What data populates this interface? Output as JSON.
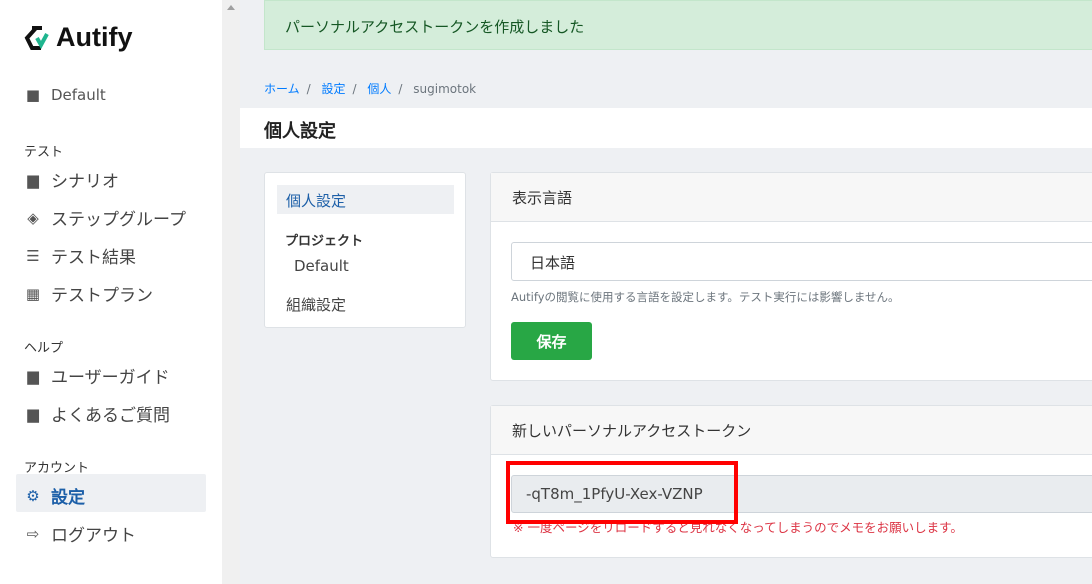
{
  "brand": "Autify",
  "sidebar": {
    "project": "Default",
    "sections": [
      {
        "title": "テスト",
        "items": [
          "シナリオ",
          "ステップグループ",
          "テスト結果",
          "テストプラン"
        ]
      },
      {
        "title": "ヘルプ",
        "items": [
          "ユーザーガイド",
          "よくあるご質問"
        ]
      },
      {
        "title": "アカウント",
        "items": [
          "設定",
          "ログアウト"
        ]
      }
    ],
    "active_item": "設定"
  },
  "alert": "パーソナルアクセストークンを作成しました",
  "breadcrumb": [
    "ホーム",
    "設定",
    "個人",
    "sugimotok"
  ],
  "page_title": "個人設定",
  "settings_nav": {
    "selected": "個人設定",
    "project_label": "プロジェクト",
    "project": "Default",
    "org": "組織設定"
  },
  "language_card": {
    "title": "表示言語",
    "value": "日本語",
    "help": "Autifyの閲覧に使用する言語を設定します。テスト実行には影響しません。",
    "save": "保存"
  },
  "token_card": {
    "title": "新しいパーソナルアクセストークン",
    "token": "-qT8m_1PfyU-Xex-VZNP",
    "warning": "※ 一度ページをリロードすると見れなくなってしまうのでメモをお願いします。"
  },
  "colors": {
    "accent": "#28a745",
    "link": "#007bff",
    "warning": "#dc3545",
    "highlight": "#ff0000"
  }
}
